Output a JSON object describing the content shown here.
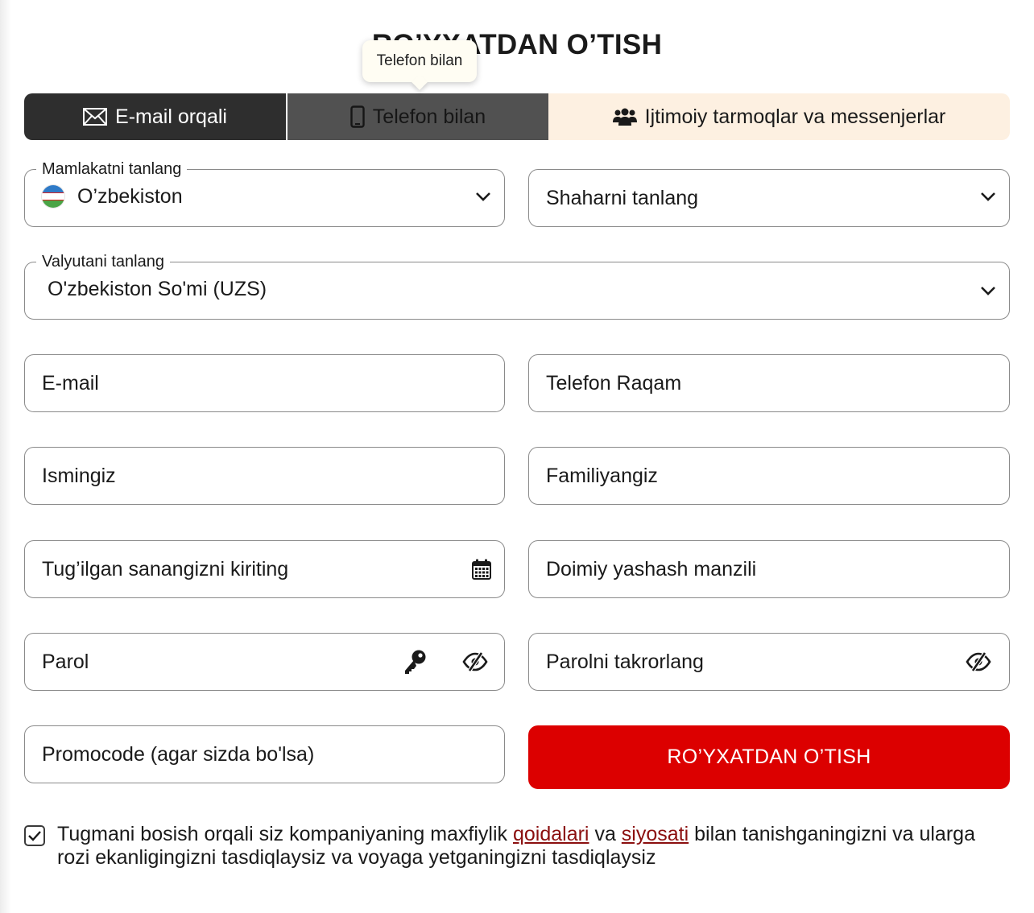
{
  "title": "RO’YXATDAN O’TISH",
  "tooltip": "Telefon bilan",
  "tabs": [
    {
      "label": "E-mail orqali",
      "icon": "envelope-icon"
    },
    {
      "label": "Telefon bilan",
      "icon": "mobile-phone-icon"
    },
    {
      "label": "Ijtimoiy tarmoqlar va messenjerlar",
      "icon": "users-icon"
    }
  ],
  "country": {
    "legend": "Mamlakatni tanlang",
    "value": "O’zbekiston"
  },
  "city": {
    "placeholder": "Shaharni tanlang"
  },
  "currency": {
    "legend": "Valyutani tanlang",
    "value": "O'zbekiston So'mi (UZS)"
  },
  "fields": {
    "email": "E-mail",
    "phone": "Telefon Raqam",
    "first_name": "Ismingiz",
    "last_name": "Familiyangiz",
    "birth_date": "Tug’ilgan sanangizni kiriting",
    "address": "Doimiy yashash manzili",
    "password": "Parol",
    "password_repeat": "Parolni takrorlang",
    "promocode": "Promocode (agar sizda bo'lsa)"
  },
  "submit_label": "RO’YXATDAN O’TISH",
  "consent": {
    "checked": true,
    "text_before": "Tugmani bosish orqali siz kompaniyaning maxfiylik ",
    "link1": "qoidalari",
    "text_middle": " va ",
    "link2": "siyosati",
    "text_after": " bilan tanishganingizni va ularga rozi ekanligingizni tasdiqlaysiz va voyaga yetganingizni tasdiqlaysiz"
  },
  "colors": {
    "accent": "#dc0000",
    "tab_active": "#2e2e2e",
    "tab_hover": "#515151",
    "tab_social": "#fdf0e1",
    "link": "#8b0f0f"
  }
}
